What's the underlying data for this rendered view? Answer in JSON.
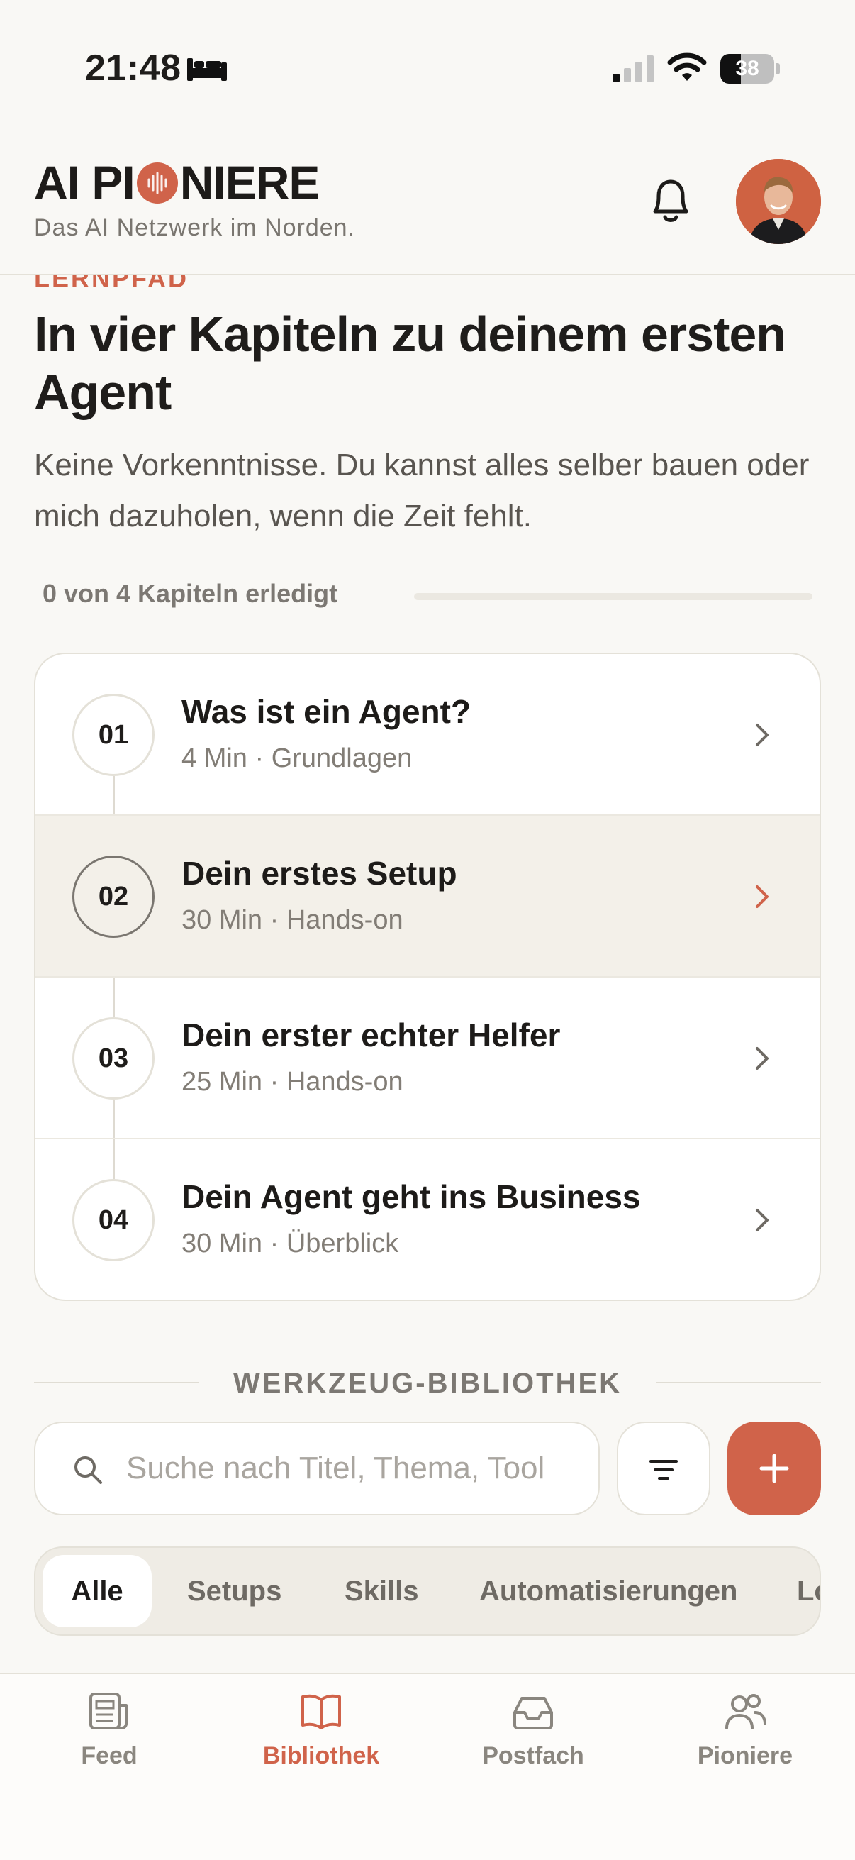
{
  "status_bar": {
    "time": "21:48",
    "battery_level": "38",
    "battery_fraction": 0.38
  },
  "header": {
    "logo_left": "AI PI",
    "logo_right": "NIERE",
    "tagline": "Das AI Netzwerk im Norden.",
    "icons": {
      "notifications": "bell-icon",
      "profile": "avatar"
    }
  },
  "lernpfad": {
    "eyebrow": "LERNPFAD",
    "title": "In vier Kapiteln zu deinem ersten Agent",
    "subtitle": "Keine Vorkenntnisse. Du kannst alles selber bauen oder mich dazuholen, wenn die Zeit fehlt.",
    "progress_text": "0 von 4 Kapiteln erledigt",
    "progress_fraction": 0,
    "chapters": [
      {
        "number": "01",
        "title": "Was ist ein Agent?",
        "meta": "4 Min · Grundlagen",
        "active": false
      },
      {
        "number": "02",
        "title": "Dein erstes Setup",
        "meta": "30 Min · Hands-on",
        "active": true
      },
      {
        "number": "03",
        "title": "Dein erster echter Helfer",
        "meta": "25 Min · Hands-on",
        "active": false
      },
      {
        "number": "04",
        "title": "Dein Agent geht ins Business",
        "meta": "30 Min · Überblick",
        "active": false
      }
    ]
  },
  "library": {
    "section_title": "WERKZEUG-BIBLIOTHEK",
    "search_placeholder": "Suche nach Titel, Thema, Tool",
    "search_value": "",
    "filter_icon": "filter-icon",
    "add_icon": "plus-icon",
    "tabs": [
      {
        "label": "Alle",
        "selected": true
      },
      {
        "label": "Setups",
        "selected": false
      },
      {
        "label": "Skills",
        "selected": false
      },
      {
        "label": "Automatisierungen",
        "selected": false
      },
      {
        "label": "Lo",
        "selected": false
      }
    ]
  },
  "bottom_nav": [
    {
      "label": "Feed",
      "icon": "newspaper-icon",
      "active": false
    },
    {
      "label": "Bibliothek",
      "icon": "book-icon",
      "active": true
    },
    {
      "label": "Postfach",
      "icon": "inbox-icon",
      "active": false
    },
    {
      "label": "Pioniere",
      "icon": "users-icon",
      "active": false
    }
  ],
  "colors": {
    "accent": "#d0634a",
    "background": "#f9f8f5",
    "text": "#1f1d1b",
    "muted": "#7c7873"
  }
}
